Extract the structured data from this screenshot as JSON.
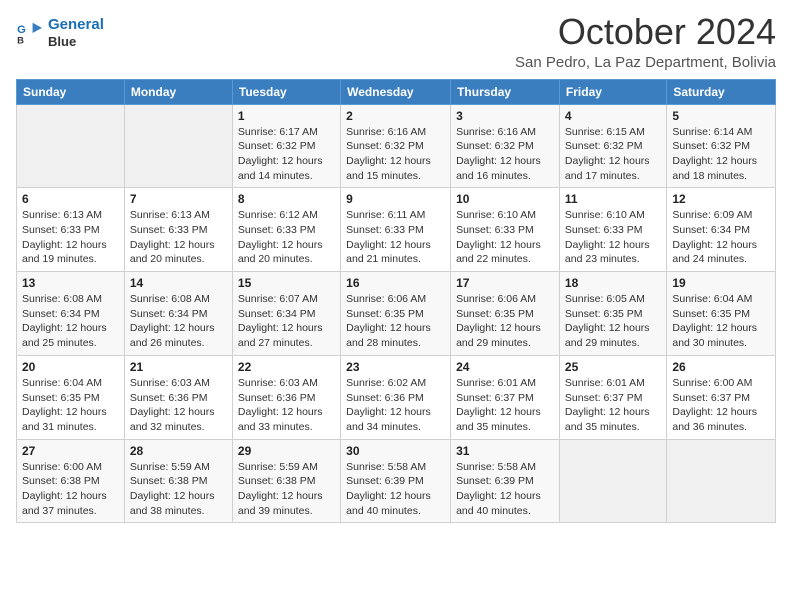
{
  "logo": {
    "line1": "General",
    "line2": "Blue"
  },
  "title": "October 2024",
  "subtitle": "San Pedro, La Paz Department, Bolivia",
  "days_of_week": [
    "Sunday",
    "Monday",
    "Tuesday",
    "Wednesday",
    "Thursday",
    "Friday",
    "Saturday"
  ],
  "weeks": [
    [
      {
        "day": "",
        "info": ""
      },
      {
        "day": "",
        "info": ""
      },
      {
        "day": "1",
        "sunrise": "Sunrise: 6:17 AM",
        "sunset": "Sunset: 6:32 PM",
        "daylight": "Daylight: 12 hours and 14 minutes."
      },
      {
        "day": "2",
        "sunrise": "Sunrise: 6:16 AM",
        "sunset": "Sunset: 6:32 PM",
        "daylight": "Daylight: 12 hours and 15 minutes."
      },
      {
        "day": "3",
        "sunrise": "Sunrise: 6:16 AM",
        "sunset": "Sunset: 6:32 PM",
        "daylight": "Daylight: 12 hours and 16 minutes."
      },
      {
        "day": "4",
        "sunrise": "Sunrise: 6:15 AM",
        "sunset": "Sunset: 6:32 PM",
        "daylight": "Daylight: 12 hours and 17 minutes."
      },
      {
        "day": "5",
        "sunrise": "Sunrise: 6:14 AM",
        "sunset": "Sunset: 6:32 PM",
        "daylight": "Daylight: 12 hours and 18 minutes."
      }
    ],
    [
      {
        "day": "6",
        "sunrise": "Sunrise: 6:13 AM",
        "sunset": "Sunset: 6:33 PM",
        "daylight": "Daylight: 12 hours and 19 minutes."
      },
      {
        "day": "7",
        "sunrise": "Sunrise: 6:13 AM",
        "sunset": "Sunset: 6:33 PM",
        "daylight": "Daylight: 12 hours and 20 minutes."
      },
      {
        "day": "8",
        "sunrise": "Sunrise: 6:12 AM",
        "sunset": "Sunset: 6:33 PM",
        "daylight": "Daylight: 12 hours and 20 minutes."
      },
      {
        "day": "9",
        "sunrise": "Sunrise: 6:11 AM",
        "sunset": "Sunset: 6:33 PM",
        "daylight": "Daylight: 12 hours and 21 minutes."
      },
      {
        "day": "10",
        "sunrise": "Sunrise: 6:10 AM",
        "sunset": "Sunset: 6:33 PM",
        "daylight": "Daylight: 12 hours and 22 minutes."
      },
      {
        "day": "11",
        "sunrise": "Sunrise: 6:10 AM",
        "sunset": "Sunset: 6:33 PM",
        "daylight": "Daylight: 12 hours and 23 minutes."
      },
      {
        "day": "12",
        "sunrise": "Sunrise: 6:09 AM",
        "sunset": "Sunset: 6:34 PM",
        "daylight": "Daylight: 12 hours and 24 minutes."
      }
    ],
    [
      {
        "day": "13",
        "sunrise": "Sunrise: 6:08 AM",
        "sunset": "Sunset: 6:34 PM",
        "daylight": "Daylight: 12 hours and 25 minutes."
      },
      {
        "day": "14",
        "sunrise": "Sunrise: 6:08 AM",
        "sunset": "Sunset: 6:34 PM",
        "daylight": "Daylight: 12 hours and 26 minutes."
      },
      {
        "day": "15",
        "sunrise": "Sunrise: 6:07 AM",
        "sunset": "Sunset: 6:34 PM",
        "daylight": "Daylight: 12 hours and 27 minutes."
      },
      {
        "day": "16",
        "sunrise": "Sunrise: 6:06 AM",
        "sunset": "Sunset: 6:35 PM",
        "daylight": "Daylight: 12 hours and 28 minutes."
      },
      {
        "day": "17",
        "sunrise": "Sunrise: 6:06 AM",
        "sunset": "Sunset: 6:35 PM",
        "daylight": "Daylight: 12 hours and 29 minutes."
      },
      {
        "day": "18",
        "sunrise": "Sunrise: 6:05 AM",
        "sunset": "Sunset: 6:35 PM",
        "daylight": "Daylight: 12 hours and 29 minutes."
      },
      {
        "day": "19",
        "sunrise": "Sunrise: 6:04 AM",
        "sunset": "Sunset: 6:35 PM",
        "daylight": "Daylight: 12 hours and 30 minutes."
      }
    ],
    [
      {
        "day": "20",
        "sunrise": "Sunrise: 6:04 AM",
        "sunset": "Sunset: 6:35 PM",
        "daylight": "Daylight: 12 hours and 31 minutes."
      },
      {
        "day": "21",
        "sunrise": "Sunrise: 6:03 AM",
        "sunset": "Sunset: 6:36 PM",
        "daylight": "Daylight: 12 hours and 32 minutes."
      },
      {
        "day": "22",
        "sunrise": "Sunrise: 6:03 AM",
        "sunset": "Sunset: 6:36 PM",
        "daylight": "Daylight: 12 hours and 33 minutes."
      },
      {
        "day": "23",
        "sunrise": "Sunrise: 6:02 AM",
        "sunset": "Sunset: 6:36 PM",
        "daylight": "Daylight: 12 hours and 34 minutes."
      },
      {
        "day": "24",
        "sunrise": "Sunrise: 6:01 AM",
        "sunset": "Sunset: 6:37 PM",
        "daylight": "Daylight: 12 hours and 35 minutes."
      },
      {
        "day": "25",
        "sunrise": "Sunrise: 6:01 AM",
        "sunset": "Sunset: 6:37 PM",
        "daylight": "Daylight: 12 hours and 35 minutes."
      },
      {
        "day": "26",
        "sunrise": "Sunrise: 6:00 AM",
        "sunset": "Sunset: 6:37 PM",
        "daylight": "Daylight: 12 hours and 36 minutes."
      }
    ],
    [
      {
        "day": "27",
        "sunrise": "Sunrise: 6:00 AM",
        "sunset": "Sunset: 6:38 PM",
        "daylight": "Daylight: 12 hours and 37 minutes."
      },
      {
        "day": "28",
        "sunrise": "Sunrise: 5:59 AM",
        "sunset": "Sunset: 6:38 PM",
        "daylight": "Daylight: 12 hours and 38 minutes."
      },
      {
        "day": "29",
        "sunrise": "Sunrise: 5:59 AM",
        "sunset": "Sunset: 6:38 PM",
        "daylight": "Daylight: 12 hours and 39 minutes."
      },
      {
        "day": "30",
        "sunrise": "Sunrise: 5:58 AM",
        "sunset": "Sunset: 6:39 PM",
        "daylight": "Daylight: 12 hours and 40 minutes."
      },
      {
        "day": "31",
        "sunrise": "Sunrise: 5:58 AM",
        "sunset": "Sunset: 6:39 PM",
        "daylight": "Daylight: 12 hours and 40 minutes."
      },
      {
        "day": "",
        "info": ""
      },
      {
        "day": "",
        "info": ""
      }
    ]
  ]
}
